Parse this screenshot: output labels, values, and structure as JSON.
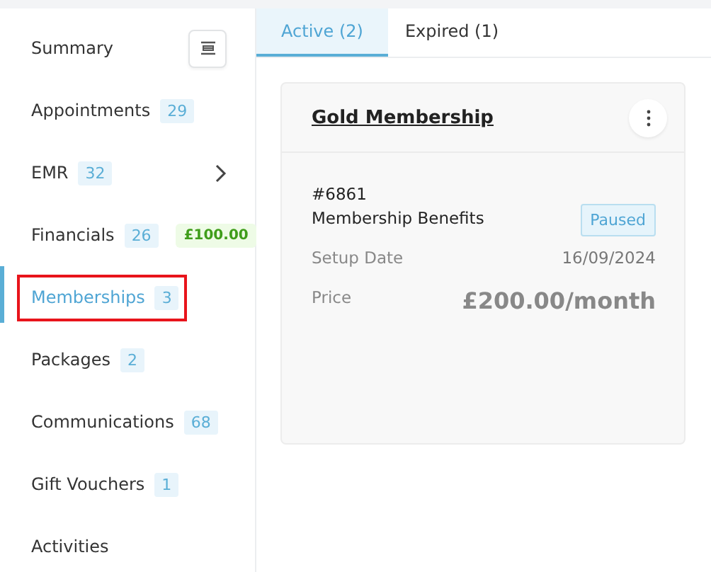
{
  "sidebar": {
    "collapse_button": true,
    "items": [
      {
        "label": "Summary",
        "selected": false
      },
      {
        "label": "Appointments",
        "count": "29",
        "selected": false
      },
      {
        "label": "EMR",
        "count": "32",
        "selected": false,
        "expandable": true
      },
      {
        "label": "Financials",
        "count": "26",
        "balance": "£100.00",
        "selected": false
      },
      {
        "label": "Memberships",
        "count": "3",
        "selected": true,
        "highlighted": true
      },
      {
        "label": "Packages",
        "count": "2",
        "selected": false
      },
      {
        "label": "Communications",
        "count": "68",
        "selected": false
      },
      {
        "label": "Gift Vouchers",
        "count": "1",
        "selected": false
      },
      {
        "label": "Activities",
        "selected": false
      }
    ]
  },
  "tabs": [
    {
      "label": "Active (2)",
      "selected": true
    },
    {
      "label": "Expired (1)",
      "selected": false
    }
  ],
  "card": {
    "title": "Gold Membership",
    "number": "#6861",
    "name": "Membership Benefits",
    "status": "Paused",
    "fields": [
      {
        "label": "Setup Date",
        "value": "16/09/2024",
        "kind": "date"
      },
      {
        "label": "Price",
        "value": "£200.00/month",
        "kind": "price"
      }
    ]
  }
}
